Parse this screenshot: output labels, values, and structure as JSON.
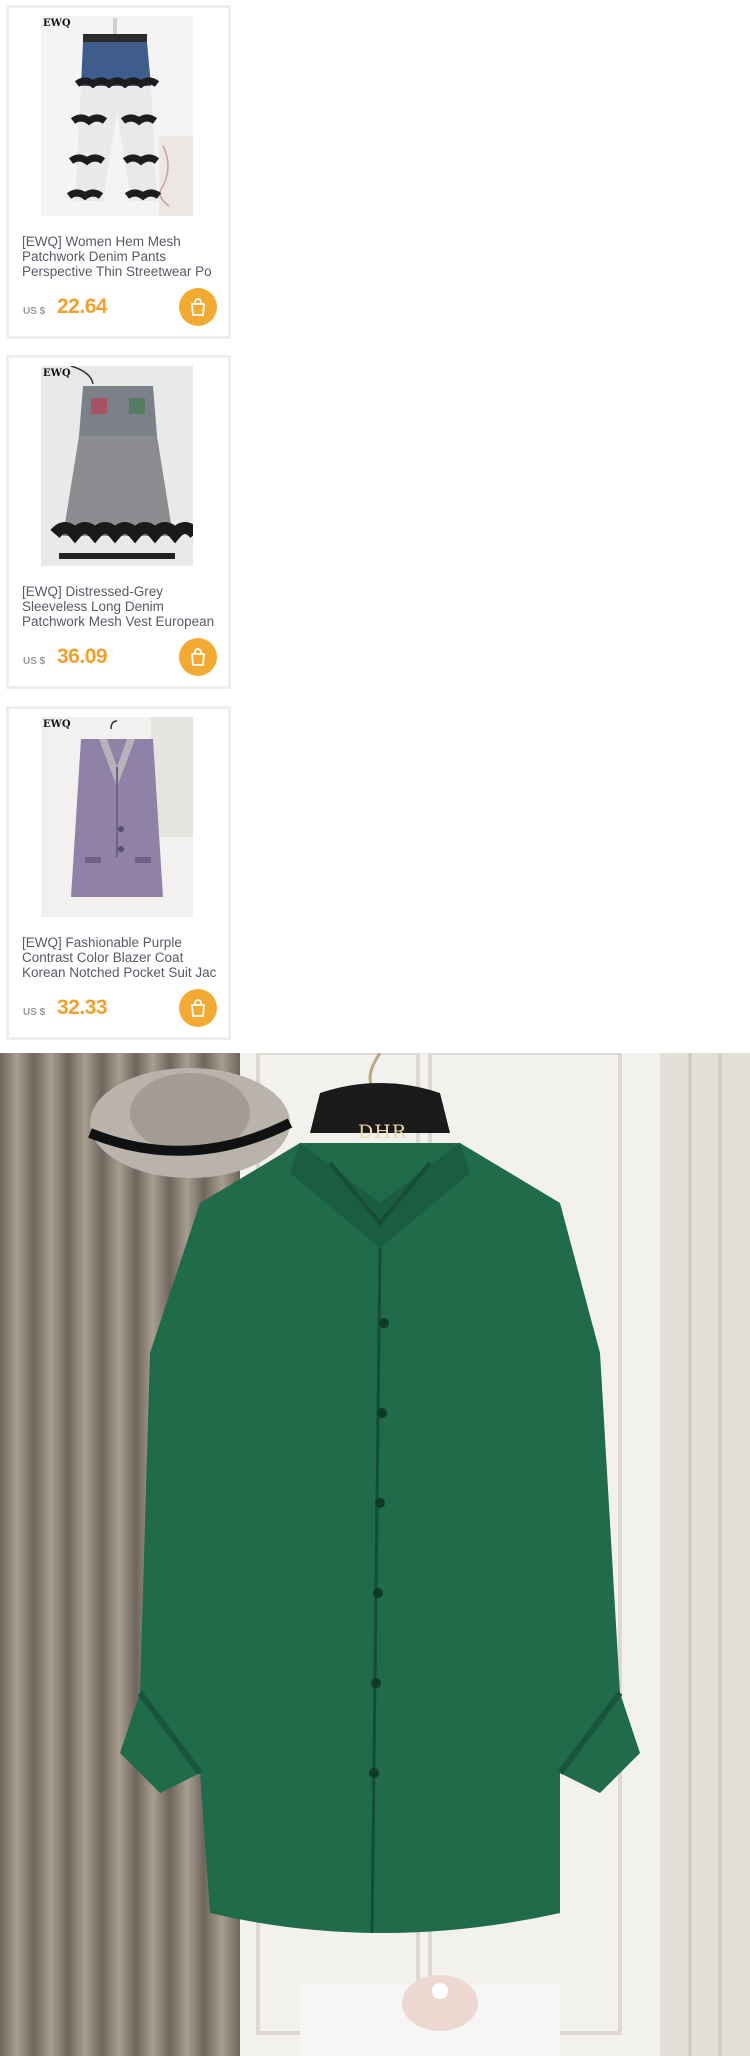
{
  "products": [
    {
      "brand": "EWQ",
      "title": "[EWQ] Women Hem Mesh Patchwork Denim Pants Perspective Thin Streetwear Po",
      "currency": "US $",
      "price": "22.64"
    },
    {
      "brand": "EWQ",
      "title": "[EWQ] Distressed-Grey Sleeveless Long Denim Patchwork Mesh Vest European",
      "currency": "US $",
      "price": "36.09"
    },
    {
      "brand": "EWQ",
      "title": "[EWQ] Fashionable Purple Contrast Color Blazer Coat Korean Notched Pocket Suit Jac",
      "currency": "US $",
      "price": "32.33"
    }
  ],
  "hero": {
    "hanger_logo": "DHR"
  },
  "colors": {
    "price": "#f2a02d",
    "cart_button": "#f3aa33",
    "title_text": "#555a66"
  },
  "icons": {
    "cart": "shopping-bag-icon"
  }
}
